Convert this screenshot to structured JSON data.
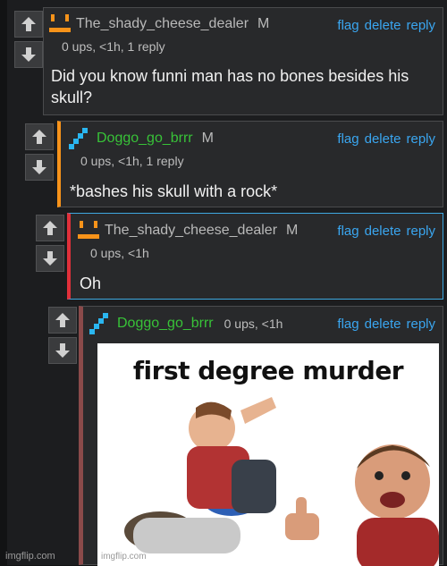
{
  "comments": [
    {
      "username": "The_shady_cheese_dealer",
      "badge": "M",
      "meta": "0 ups, <1h, 1 reply",
      "text": "Did you know funni man has no bones besides his skull?",
      "avatar_icon": "orange-face-icon"
    },
    {
      "username": "Doggo_go_brrr",
      "badge": "M",
      "meta": "0 ups, <1h, 1 reply",
      "text": "*bashes his skull with a rock*",
      "avatar_icon": "blue-pixel-icon"
    },
    {
      "username": "The_shady_cheese_dealer",
      "badge": "M",
      "meta": "0 ups, <1h",
      "text": "Oh",
      "avatar_icon": "orange-face-icon"
    },
    {
      "username": "Doggo_go_brrr",
      "meta": "0 ups, <1h",
      "avatar_icon": "blue-pixel-icon"
    }
  ],
  "actions": {
    "flag": "flag",
    "delete": "delete",
    "reply": "reply"
  },
  "meme": {
    "caption": "first degree murder",
    "watermark": "imgflip.com"
  },
  "watermark": "imgflip.com",
  "colors": {
    "username_gray": "#b9b9b9",
    "username_green": "#38c238",
    "link_blue": "#3aa6f0",
    "thread_orange": "#f7931a",
    "thread_red": "#e0303a",
    "thread_maroon": "#8a4a4a"
  }
}
